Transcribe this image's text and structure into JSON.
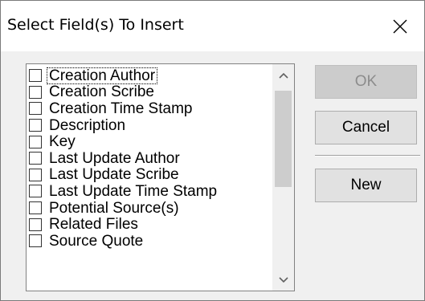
{
  "window": {
    "title": "Select Field(s) To Insert",
    "close_icon": "close-icon"
  },
  "field_list": {
    "items": [
      {
        "label": "Creation Author",
        "checked": false,
        "focused": true
      },
      {
        "label": "Creation Scribe",
        "checked": false
      },
      {
        "label": "Creation Time Stamp",
        "checked": false
      },
      {
        "label": "Description",
        "checked": false
      },
      {
        "label": "Key",
        "checked": false
      },
      {
        "label": "Last Update Author",
        "checked": false
      },
      {
        "label": "Last Update Scribe",
        "checked": false
      },
      {
        "label": "Last Update Time Stamp",
        "checked": false
      },
      {
        "label": "Potential Source(s)",
        "checked": false
      },
      {
        "label": "Related Files",
        "checked": false
      },
      {
        "label": "Source Quote",
        "checked": false
      }
    ],
    "scroll_position": 0,
    "scroll_up_icon": "chevron-up-icon",
    "scroll_down_icon": "chevron-down-icon"
  },
  "buttons": {
    "ok_label": "OK",
    "ok_enabled": false,
    "cancel_label": "Cancel",
    "new_label": "New"
  }
}
